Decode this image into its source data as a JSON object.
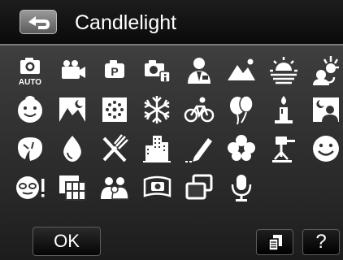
{
  "header": {
    "back_icon": "return-arrow-icon",
    "title": "Candlelight"
  },
  "scene_modes": [
    {
      "icon": "camera-auto-icon",
      "label": "AUTO"
    },
    {
      "icon": "video-camera-icon"
    },
    {
      "icon": "program-p-icon",
      "label": "P"
    },
    {
      "icon": "camera-info-icon"
    },
    {
      "icon": "portrait-suit-icon"
    },
    {
      "icon": "landscape-mountains-icon"
    },
    {
      "icon": "sunset-icon"
    },
    {
      "icon": "night-portrait-icon"
    },
    {
      "icon": "child-face-icon"
    },
    {
      "icon": "night-landscape-icon"
    },
    {
      "icon": "fireworks-icon"
    },
    {
      "icon": "snowflake-icon"
    },
    {
      "icon": "bicycle-sport-icon"
    },
    {
      "icon": "party-balloons-icon"
    },
    {
      "icon": "candlelight-icon"
    },
    {
      "icon": "night-portrait-moon-icon"
    },
    {
      "icon": "leaf-nature-icon"
    },
    {
      "icon": "water-drop-icon"
    },
    {
      "icon": "food-utensils-icon"
    },
    {
      "icon": "building-icon"
    },
    {
      "icon": "pencil-sketch-icon"
    },
    {
      "icon": "flower-icon"
    },
    {
      "icon": "tripod-icon"
    },
    {
      "icon": "smile-face-icon"
    },
    {
      "icon": "blink-detection-icon"
    },
    {
      "icon": "collage-frame-icon"
    },
    {
      "icon": "group-people-icon"
    },
    {
      "icon": "panorama-camera-icon"
    },
    {
      "icon": "multi-frame-icon"
    },
    {
      "icon": "voice-recording-icon"
    }
  ],
  "footer": {
    "ok_label": "OK",
    "menu_icon": "menu-pages-icon",
    "help_label": "?"
  }
}
